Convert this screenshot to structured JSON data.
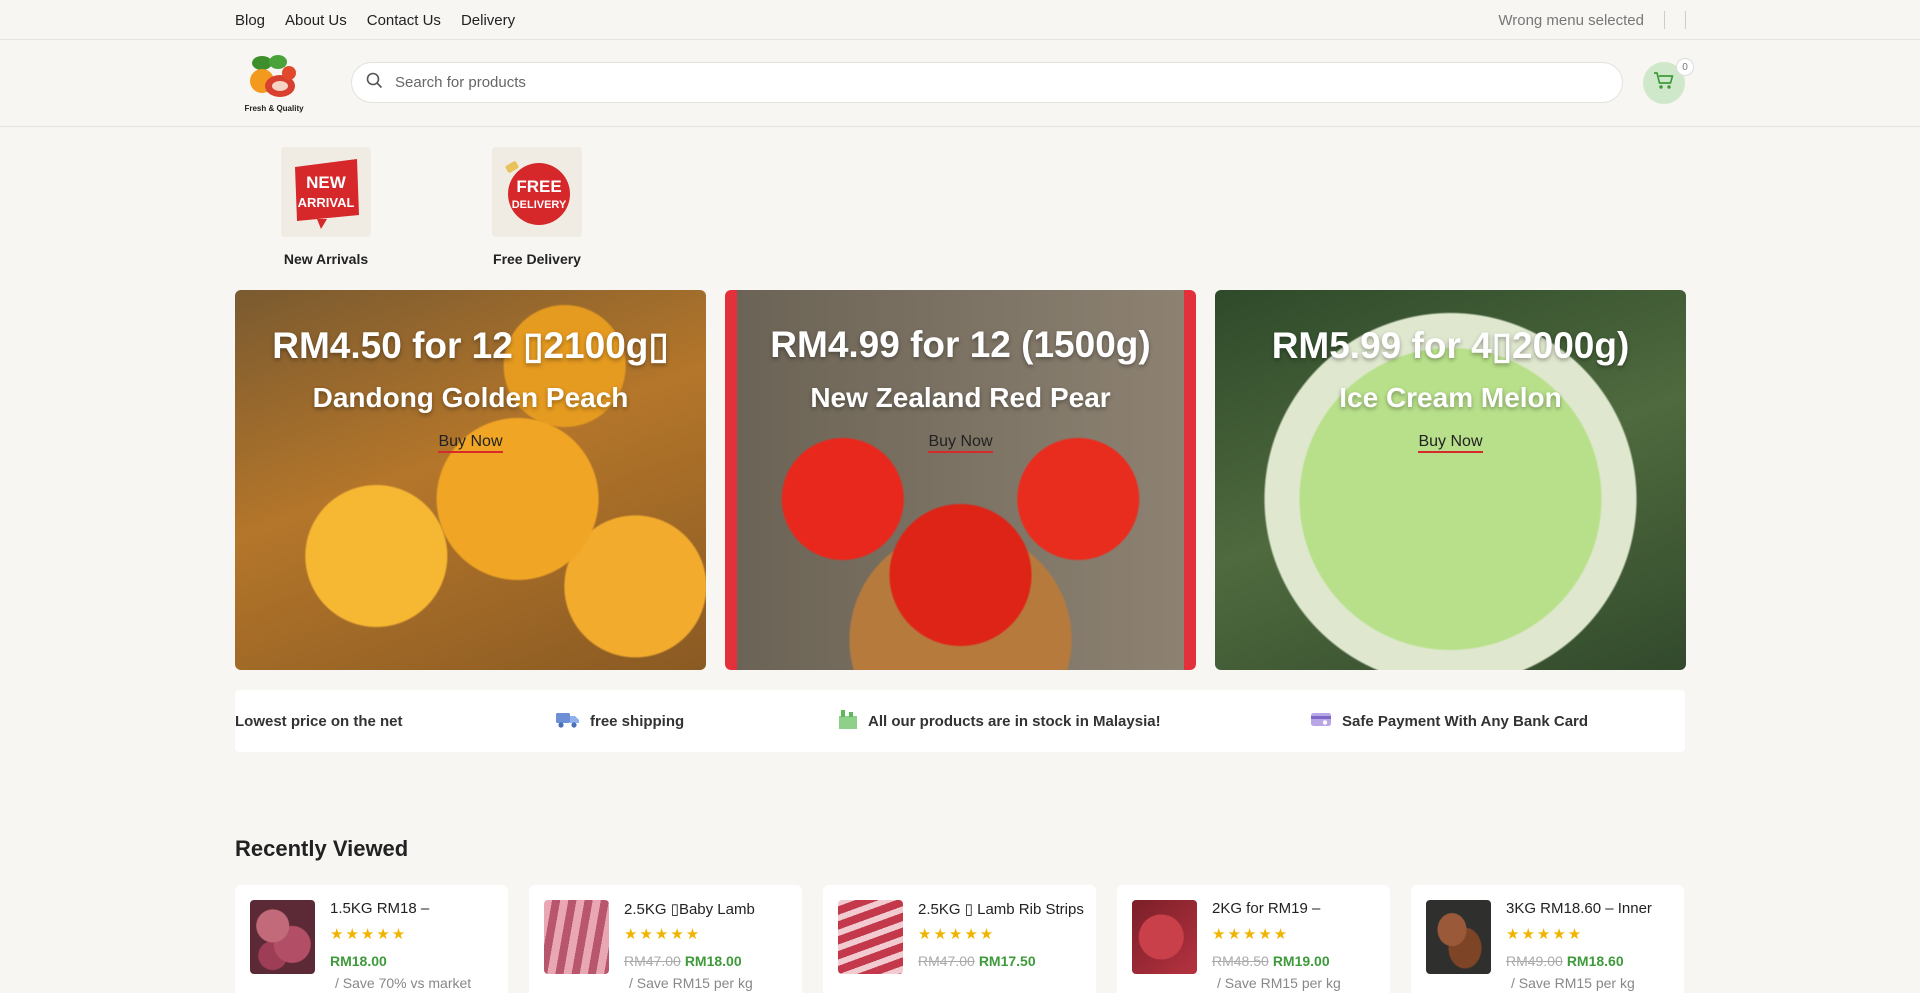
{
  "topbar": {
    "links": [
      "Blog",
      "About Us",
      "Contact Us",
      "Delivery"
    ],
    "menu_status": "Wrong menu selected"
  },
  "header": {
    "logo_caption": "Fresh & Quality",
    "search_placeholder": "Search for products",
    "cart_count": "0"
  },
  "categories": [
    {
      "label": "New Arrivals",
      "tile_text": [
        "NEW",
        "ARRIVAL"
      ]
    },
    {
      "label": "Free Delivery",
      "tile_text": [
        "FREE",
        "DELIVERY"
      ]
    }
  ],
  "banners": [
    {
      "title": "RM4.50 for 12 ▯2100g▯",
      "subtitle": "Dandong Golden Peach",
      "cta": "Buy Now"
    },
    {
      "title": "RM4.99 for 12 (1500g)",
      "subtitle": "New Zealand Red Pear",
      "cta": "Buy Now"
    },
    {
      "title": "RM5.99 for 4▯2000g)",
      "subtitle": "Ice Cream Melon",
      "cta": "Buy Now"
    }
  ],
  "features": [
    {
      "text": "Lowest price on the net",
      "icon": "none"
    },
    {
      "text": "free shipping",
      "icon": "truck-icon"
    },
    {
      "text": "All our products are in stock in Malaysia!",
      "icon": "warehouse-icon"
    },
    {
      "text": "Safe Payment With Any Bank Card",
      "icon": "card-icon"
    }
  ],
  "recently_viewed": {
    "title": "Recently Viewed",
    "items": [
      {
        "name": "1.5KG RM18 –",
        "stars": "★★★★★",
        "old_price": "",
        "price": "RM18.00",
        "note": "/ Save 70% vs market"
      },
      {
        "name": "2.5KG ▯Baby Lamb",
        "stars": "★★★★★",
        "old_price": "RM47.00",
        "price": "RM18.00",
        "note": "/ Save RM15 per kg"
      },
      {
        "name": "2.5KG ▯ Lamb Rib Strips",
        "stars": "★★★★★",
        "old_price": "RM47.00",
        "price": "RM17.50",
        "note": ""
      },
      {
        "name": "2KG for RM19 –",
        "stars": "★★★★★",
        "old_price": "RM48.50",
        "price": "RM19.00",
        "note": "/ Save RM15 per kg"
      },
      {
        "name": "3KG RM18.60 – Inner",
        "stars": "★★★★★",
        "old_price": "RM49.00",
        "price": "RM18.60",
        "note": "/ Save RM15 per kg"
      }
    ]
  },
  "colors": {
    "accent_green": "#3f9a3b",
    "accent_red": "#d72b2b",
    "star": "#f0b400"
  }
}
